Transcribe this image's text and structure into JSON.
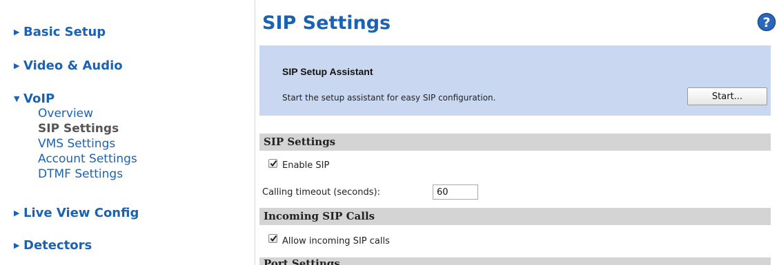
{
  "sidebar": {
    "basic_setup": "Basic Setup",
    "video_audio": "Video & Audio",
    "voip": "VoIP",
    "voip_items": [
      "Overview",
      "SIP Settings",
      "VMS Settings",
      "Account Settings",
      "DTMF Settings"
    ],
    "active_item": "SIP Settings",
    "live_view_config": "Live View Config",
    "detectors": "Detectors"
  },
  "icons": {
    "collapsed_caret": "caret-right-icon",
    "expanded_caret": "caret-down-icon",
    "help": "help-icon",
    "check": "check-icon"
  },
  "main": {
    "title": "SIP Settings",
    "assistant": {
      "title": "SIP Setup Assistant",
      "description": "Start the setup assistant for easy SIP configuration.",
      "start_label": "Start..."
    },
    "sip_settings_header": "SIP Settings",
    "enable_sip_label": "Enable SIP",
    "enable_sip_checked": true,
    "calling_timeout_label": "Calling timeout (seconds):",
    "calling_timeout_value": "60",
    "incoming_header": "Incoming SIP Calls",
    "allow_incoming_label": "Allow incoming SIP calls",
    "allow_incoming_checked": true,
    "port_header": "Port Settings"
  },
  "colors": {
    "link": "#1b62b2",
    "active": "#555555",
    "assistant_bg": "#c9d8f0",
    "section_bg": "#d4d4d4",
    "help_icon": "#2a67b8"
  }
}
